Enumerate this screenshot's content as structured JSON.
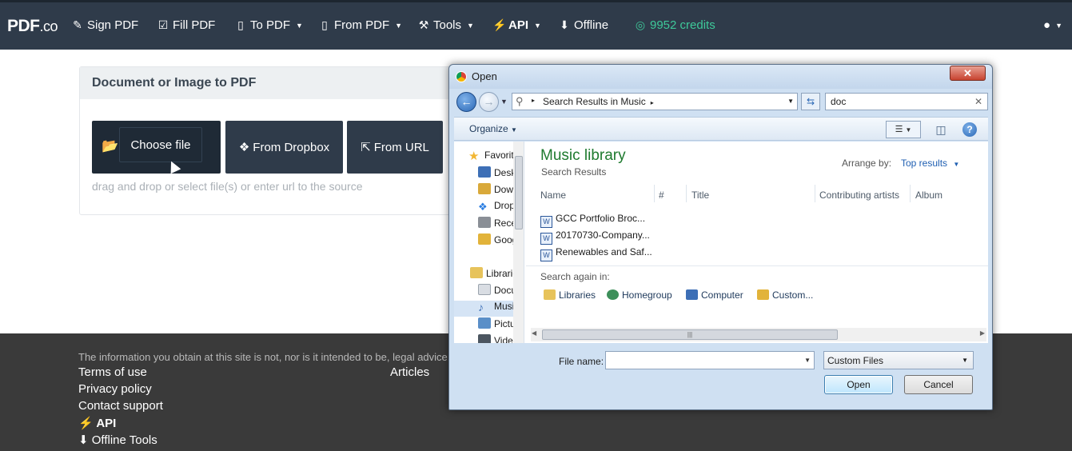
{
  "navbar": {
    "brand_main": "PDF",
    "brand_suffix": ".co",
    "items": [
      {
        "icon": "pen-icon",
        "glyph": "✎",
        "label": "Sign PDF"
      },
      {
        "icon": "checkbox-icon",
        "glyph": "☑",
        "label": "Fill PDF"
      },
      {
        "icon": "pdf-file-icon",
        "glyph": "▯",
        "label": "To PDF"
      },
      {
        "icon": "pdf-file-icon",
        "glyph": "▯",
        "label": "From PDF"
      },
      {
        "icon": "wrench-icon",
        "glyph": "⚒",
        "label": "Tools"
      },
      {
        "icon": "plug-icon",
        "glyph": "⚡",
        "label": "API"
      },
      {
        "icon": "download-icon",
        "glyph": "⬇",
        "label": "Offline"
      },
      {
        "icon": "coins-icon",
        "glyph": "◎",
        "label": "9952 credits"
      }
    ],
    "user_icon": "user-circle-icon"
  },
  "panel": {
    "title": "Document or Image to PDF",
    "choose_file": "Choose file",
    "from_dropbox": "From Dropbox",
    "from_url": "From URL",
    "hint": "drag and drop or select file(s) or enter url to the source"
  },
  "footer": {
    "disclaimer": "The information you obtain at this site is not, nor is it intended to be, legal advice.",
    "links": [
      "Terms of use",
      "Privacy policy",
      "Contact support",
      "API",
      "Offline Tools"
    ],
    "articles": "Articles"
  },
  "dialog": {
    "title": "Open",
    "close": "✕",
    "address": {
      "prefix_arrow": "▸",
      "path": "Search Results in Music",
      "suffix_arrow": "▸"
    },
    "search_value": "doc",
    "organize": "Organize",
    "tree": [
      {
        "label": "Favorites",
        "icon": "star-icon",
        "color": "#f2b632"
      },
      {
        "label": "Desktop",
        "icon": "desktop-icon",
        "color": "#3d6fb6"
      },
      {
        "label": "Downloads",
        "icon": "downloads-folder-icon",
        "color": "#d9a93a"
      },
      {
        "label": "Dropbox",
        "icon": "dropbox-icon",
        "color": "#2a7de1"
      },
      {
        "label": "Recent Places",
        "icon": "recent-places-icon",
        "color": "#8a8f96"
      },
      {
        "label": "Google Drive",
        "icon": "google-drive-icon",
        "color": "#e2b33a"
      },
      {
        "label": "Libraries",
        "icon": "libraries-icon",
        "color": "#e7c35b"
      },
      {
        "label": "Documents",
        "icon": "documents-icon",
        "color": "#d9dde3"
      },
      {
        "label": "Music",
        "icon": "music-icon",
        "color": "#3d6fb6"
      },
      {
        "label": "Pictures",
        "icon": "pictures-icon",
        "color": "#5a8fc8"
      },
      {
        "label": "Videos",
        "icon": "videos-icon",
        "color": "#4b5560"
      }
    ],
    "library_title": "Music library",
    "library_subtitle": "Search Results",
    "arrange_label": "Arrange by:",
    "arrange_value": "Top results",
    "columns": [
      "Name",
      "#",
      "Title",
      "Contributing artists",
      "Album"
    ],
    "files": [
      "GCC Portfolio Broc...",
      "20170730-Company...",
      "Renewables and Saf..."
    ],
    "search_again_label": "Search again in:",
    "search_again_locations": [
      {
        "label": "Libraries",
        "icon": "libraries-icon",
        "color": "#e7c35b"
      },
      {
        "label": "Homegroup",
        "icon": "homegroup-icon",
        "color": "#3d8f5a"
      },
      {
        "label": "Computer",
        "icon": "computer-icon",
        "color": "#3d6fb6"
      },
      {
        "label": "Custom...",
        "icon": "custom-folder-icon",
        "color": "#e2b33a"
      }
    ],
    "file_name_label": "File name:",
    "file_name_value": "",
    "file_type": "Custom Files",
    "open_button": "Open",
    "cancel_button": "Cancel"
  }
}
